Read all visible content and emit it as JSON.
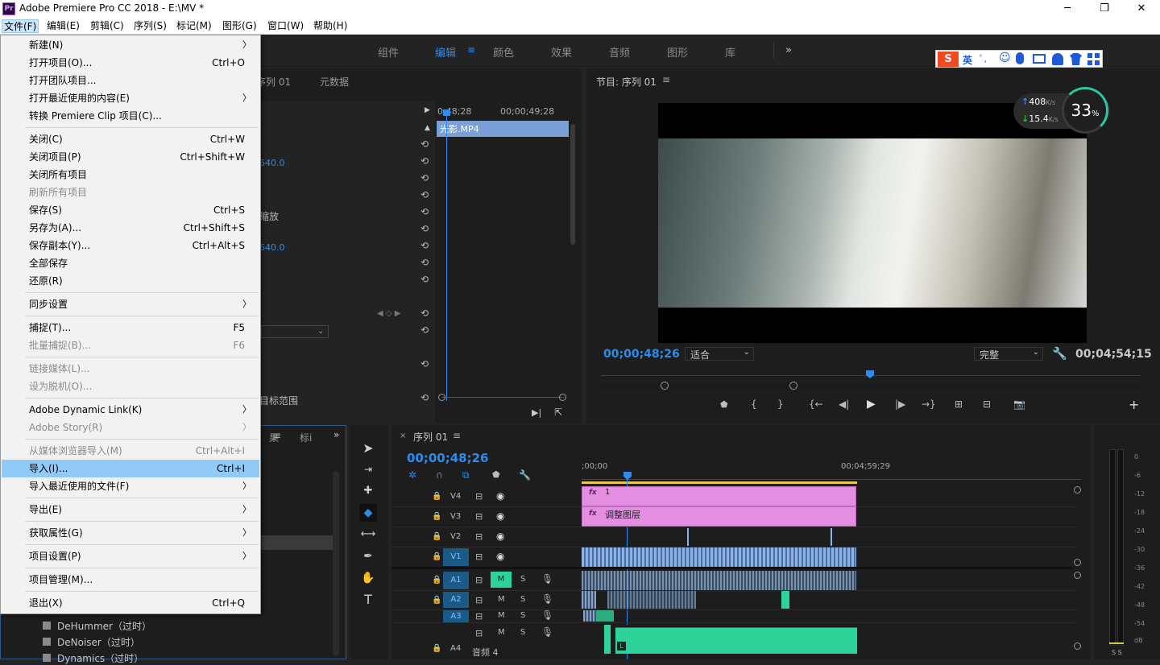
{
  "window": {
    "title": "Adobe Premiere Pro CC 2018 - E:\\MV *",
    "logo": "Pr",
    "controls": [
      "─",
      "❐",
      "✕"
    ]
  },
  "menubar": [
    "文件(F)",
    "编辑(E)",
    "剪辑(C)",
    "序列(S)",
    "标记(M)",
    "图形(G)",
    "窗口(W)",
    "帮助(H)"
  ],
  "workspaces": [
    "组件",
    "编辑",
    "颜色",
    "效果",
    "音频",
    "图形",
    "库"
  ],
  "workspace_more": "»",
  "ime": {
    "lang": "英",
    "items": [
      "ﾟ,",
      "☺",
      "🎤",
      "⌨",
      "👤",
      "👕",
      "▦"
    ]
  },
  "source_panel": {
    "tabs": [
      "序列 01",
      "元数据"
    ],
    "time_a": "0;48;28",
    "time_b": "00;00;49;28",
    "clip": "光影.MP4",
    "val1": "640.0",
    "val2": "640.0",
    "fragment1": "缩放",
    "fragment2": "目标范围"
  },
  "program": {
    "title": "节目: 序列 01",
    "timecode": "00;00;48;26",
    "fit": "适合",
    "quality": "完整",
    "duration": "00;04;54;15"
  },
  "netspeed": {
    "up": "408",
    "up_unit": "K/s",
    "down": "15.4",
    "down_unit": "K/s",
    "percent": "33",
    "pct_sign": "%"
  },
  "timeline": {
    "tab": "序列 01",
    "timecode": "00;00;48;26",
    "ruler_start": ";00;00",
    "ruler_end": "00;04;59;29",
    "tracks": [
      {
        "name": "V4"
      },
      {
        "name": "V3"
      },
      {
        "name": "V2"
      },
      {
        "name": "V1"
      },
      {
        "name": "A1"
      },
      {
        "name": "A2"
      },
      {
        "name": "A3"
      },
      {
        "name": "A4",
        "label": "音频 4"
      }
    ],
    "clip_v4": "1",
    "clip_v3": "调整图层",
    "m": "M",
    "s": "S"
  },
  "effects_panel": {
    "tab_a": "果",
    "tab_b": "标i",
    "items": [
      "DeHummer（过时）",
      "DeNoiser（过时）",
      "Dynamics（过时）"
    ]
  },
  "audio_meter": {
    "labels": [
      "0",
      "-6",
      "-12",
      "-18",
      "-24",
      "-30",
      "-36",
      "-42",
      "-48",
      "-54",
      "dB"
    ],
    "ss": "S S"
  },
  "file_menu": [
    {
      "label": "新建(N)",
      "sc": "",
      "arrow": true,
      "disabled": false
    },
    {
      "label": "打开项目(O)...",
      "sc": "Ctrl+O",
      "disabled": false
    },
    {
      "label": "打开团队项目...",
      "sc": "",
      "disabled": false
    },
    {
      "label": "打开最近使用的内容(E)",
      "sc": "",
      "arrow": true,
      "disabled": false
    },
    {
      "label": "转换 Premiere Clip 项目(C)...",
      "sc": "",
      "disabled": false
    },
    {
      "label": "关闭(C)",
      "sc": "Ctrl+W",
      "disabled": false
    },
    {
      "label": "关闭项目(P)",
      "sc": "Ctrl+Shift+W",
      "disabled": false
    },
    {
      "label": "关闭所有项目",
      "sc": "",
      "disabled": false
    },
    {
      "label": "刷新所有项目",
      "sc": "",
      "disabled": true
    },
    {
      "label": "保存(S)",
      "sc": "Ctrl+S",
      "disabled": false
    },
    {
      "label": "另存为(A)...",
      "sc": "Ctrl+Shift+S",
      "disabled": false
    },
    {
      "label": "保存副本(Y)...",
      "sc": "Ctrl+Alt+S",
      "disabled": false
    },
    {
      "label": "全部保存",
      "sc": "",
      "disabled": false
    },
    {
      "label": "还原(R)",
      "sc": "",
      "disabled": false
    },
    {
      "label": "同步设置",
      "sc": "",
      "arrow": true,
      "disabled": false
    },
    {
      "label": "捕捉(T)...",
      "sc": "F5",
      "disabled": false
    },
    {
      "label": "批量捕捉(B)...",
      "sc": "F6",
      "disabled": true
    },
    {
      "label": "链接媒体(L)...",
      "sc": "",
      "disabled": true
    },
    {
      "label": "设为脱机(O)...",
      "sc": "",
      "disabled": true
    },
    {
      "label": "Adobe Dynamic Link(K)",
      "sc": "",
      "arrow": true,
      "disabled": false
    },
    {
      "label": "Adobe Story(R)",
      "sc": "",
      "arrow": true,
      "disabled": true
    },
    {
      "label": "从媒体浏览器导入(M)",
      "sc": "Ctrl+Alt+I",
      "disabled": true
    },
    {
      "label": "导入(I)...",
      "sc": "Ctrl+I",
      "disabled": false,
      "highlight": true
    },
    {
      "label": "导入最近使用的文件(F)",
      "sc": "",
      "arrow": true,
      "disabled": false
    },
    {
      "label": "导出(E)",
      "sc": "",
      "arrow": true,
      "disabled": false
    },
    {
      "label": "获取属性(G)",
      "sc": "",
      "arrow": true,
      "disabled": false
    },
    {
      "label": "项目设置(P)",
      "sc": "",
      "arrow": true,
      "disabled": false
    },
    {
      "label": "项目管理(M)...",
      "sc": "",
      "disabled": false
    },
    {
      "label": "退出(X)",
      "sc": "Ctrl+Q",
      "disabled": false
    }
  ],
  "colors": {
    "accent": "#2d8ceb",
    "highlight": "#91c9f7",
    "clip_pink": "#e38ee0",
    "clip_green": "#2ed39a"
  }
}
